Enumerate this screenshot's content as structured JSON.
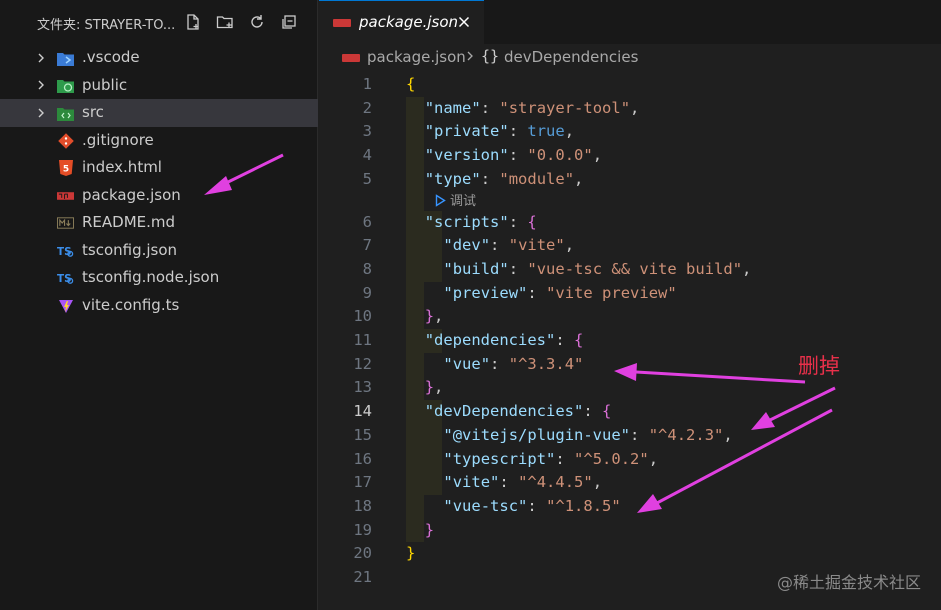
{
  "explorer": {
    "title": "文件夹: STRAYER-TO...",
    "actions": [
      "new-file-icon",
      "new-folder-icon",
      "refresh-icon",
      "collapse-all-icon"
    ]
  },
  "tree": [
    {
      "label": ".vscode",
      "type": "folder",
      "icon": "vscode-folder-icon"
    },
    {
      "label": "public",
      "type": "folder",
      "icon": "public-folder-icon"
    },
    {
      "label": "src",
      "type": "folder",
      "icon": "src-folder-icon",
      "selected": true
    },
    {
      "label": ".gitignore",
      "type": "file",
      "icon": "git-icon"
    },
    {
      "label": "index.html",
      "type": "file",
      "icon": "html-icon"
    },
    {
      "label": "package.json",
      "type": "file",
      "icon": "npm-icon"
    },
    {
      "label": "README.md",
      "type": "file",
      "icon": "markdown-icon"
    },
    {
      "label": "tsconfig.json",
      "type": "file",
      "icon": "ts-config-icon"
    },
    {
      "label": "tsconfig.node.json",
      "type": "file",
      "icon": "ts-config-icon"
    },
    {
      "label": "vite.config.ts",
      "type": "file",
      "icon": "vite-icon"
    }
  ],
  "tab": {
    "label": "package.json",
    "close": "×"
  },
  "breadcrumb": {
    "file": "package.json",
    "symbol_glyph": "{}",
    "symbol": "devDependencies"
  },
  "codelens": "调试",
  "current_line": 14,
  "lines": [
    {
      "n": "1",
      "t": "{"
    },
    {
      "n": "2",
      "t": "  \"name\": \"strayer-tool\","
    },
    {
      "n": "3",
      "t": "  \"private\": true,"
    },
    {
      "n": "4",
      "t": "  \"version\": \"0.0.0\","
    },
    {
      "n": "5",
      "t": "  \"type\": \"module\","
    },
    {
      "n": "6",
      "t": "  \"scripts\": {"
    },
    {
      "n": "7",
      "t": "    \"dev\": \"vite\","
    },
    {
      "n": "8",
      "t": "    \"build\": \"vue-tsc && vite build\","
    },
    {
      "n": "9",
      "t": "    \"preview\": \"vite preview\""
    },
    {
      "n": "10",
      "t": "  },"
    },
    {
      "n": "11",
      "t": "  \"dependencies\": {"
    },
    {
      "n": "12",
      "t": "    \"vue\": \"^3.3.4\""
    },
    {
      "n": "13",
      "t": "  },"
    },
    {
      "n": "14",
      "t": "  \"devDependencies\": {"
    },
    {
      "n": "15",
      "t": "    \"@vitejs/plugin-vue\": \"^4.2.3\","
    },
    {
      "n": "16",
      "t": "    \"typescript\": \"^5.0.2\","
    },
    {
      "n": "17",
      "t": "    \"vite\": \"^4.4.5\","
    },
    {
      "n": "18",
      "t": "    \"vue-tsc\": \"^1.8.5\""
    },
    {
      "n": "19",
      "t": "  }"
    },
    {
      "n": "20",
      "t": "}"
    },
    {
      "n": "21",
      "t": ""
    }
  ],
  "annotation": {
    "label": "删掉",
    "color": "#e8304a",
    "arrow_color": "#e040e0"
  },
  "watermark": "@稀土掘金技术社区",
  "colors": {
    "key": "#9cdcfe",
    "string": "#ce9178",
    "bracket1": "#ffd700",
    "bracket2": "#da70d6",
    "keyword": "#569cd6"
  }
}
